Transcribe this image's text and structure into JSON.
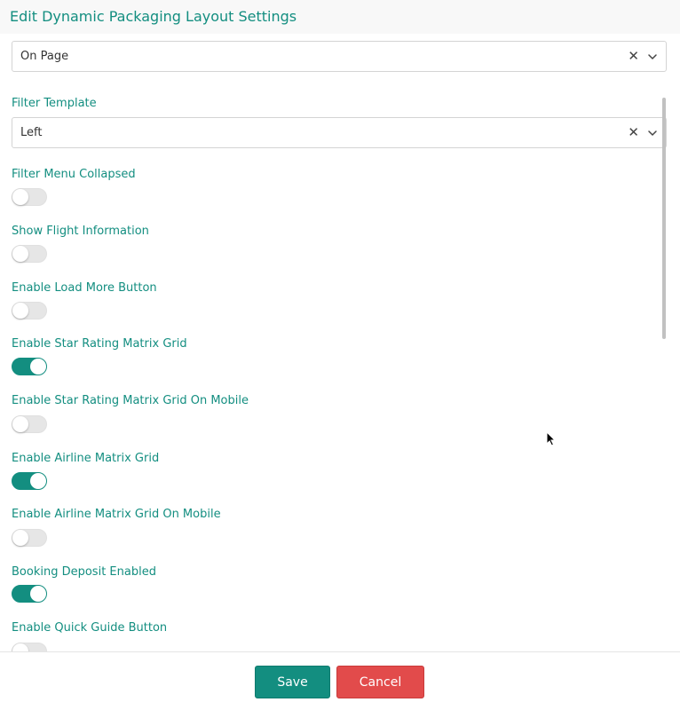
{
  "modal": {
    "title": "Edit Dynamic Packaging Layout Settings"
  },
  "fields": {
    "top_select": {
      "value": "On Page"
    },
    "filter_template": {
      "label": "Filter Template",
      "value": "Left"
    },
    "toggles": [
      {
        "label": "Filter Menu Collapsed",
        "on": false
      },
      {
        "label": "Show Flight Information",
        "on": false
      },
      {
        "label": "Enable Load More Button",
        "on": false
      },
      {
        "label": "Enable Star Rating Matrix Grid",
        "on": true
      },
      {
        "label": "Enable Star Rating Matrix Grid On Mobile",
        "on": false
      },
      {
        "label": "Enable Airline Matrix Grid",
        "on": true
      },
      {
        "label": "Enable Airline Matrix Grid On Mobile",
        "on": false
      },
      {
        "label": "Booking Deposit Enabled",
        "on": true
      },
      {
        "label": "Enable Quick Guide Button",
        "on": false
      }
    ]
  },
  "icons": {
    "clear": "close-icon",
    "dropdown": "chevron-down-icon",
    "cursor": "cursor-arrow-icon"
  },
  "footer": {
    "save_label": "Save",
    "cancel_label": "Cancel"
  },
  "colors": {
    "accent": "#138e80",
    "danger": "#e24b4b",
    "toggle_off": "#e6e6e6"
  }
}
